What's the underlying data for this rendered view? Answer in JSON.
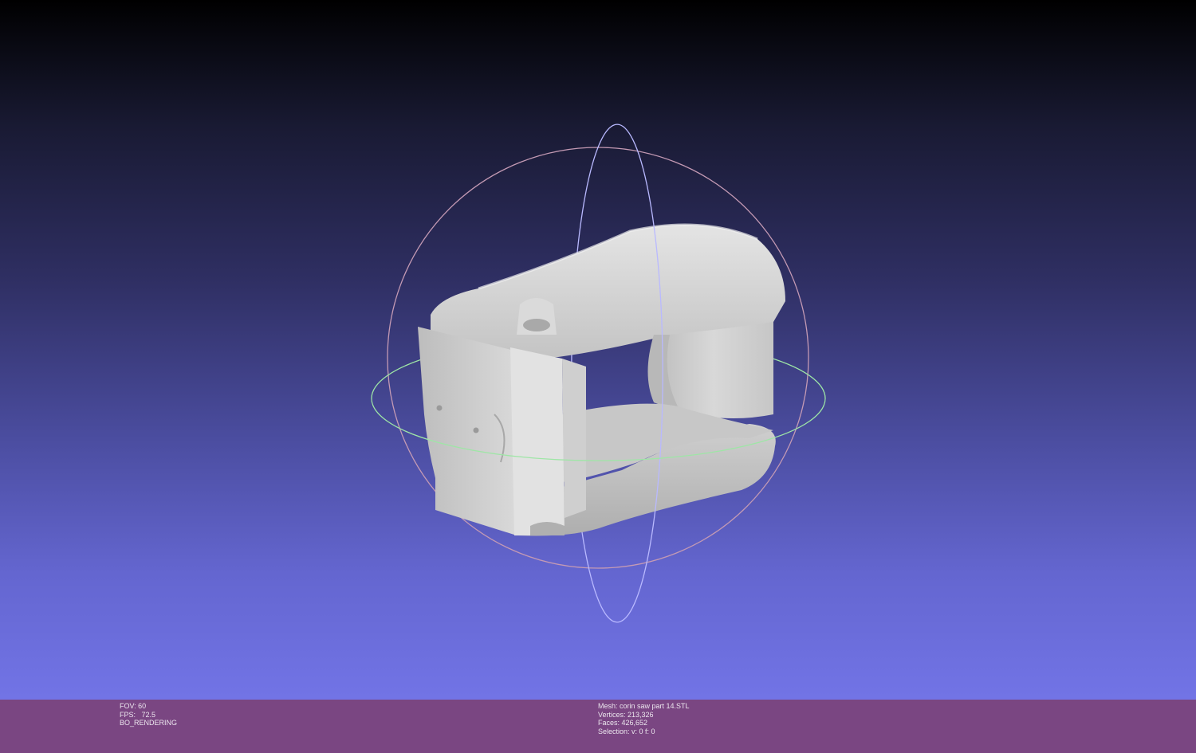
{
  "render_info": {
    "fov": "FOV: 60",
    "fps": "FPS:   72.5",
    "mode": "BO_RENDERING"
  },
  "mesh_info": {
    "mesh": "Mesh: corin saw part 14.STL",
    "vertices": "Vertices: 213,326",
    "faces": "Faces: 426,652",
    "selection": "Selection: v: 0 f: 0"
  },
  "colors": {
    "statusbar": "#7a4682",
    "trackball_horizontal": "#9ee6a6",
    "trackball_vertical": "#b9b9ff",
    "trackball_outline": "#c49ab4",
    "model": "#d6d6d6"
  },
  "icons": {
    "trackball": "trackball-gizmo",
    "model": "3d-mesh-model"
  }
}
